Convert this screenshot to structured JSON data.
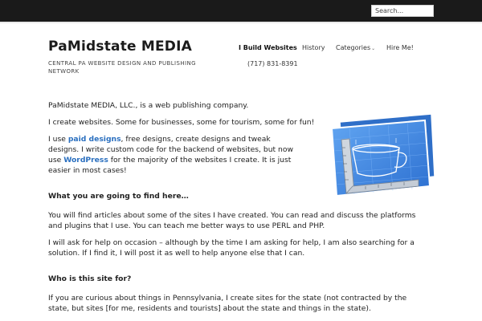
{
  "search": {
    "placeholder": "Search..."
  },
  "header": {
    "site_title": "PaMidstate MEDIA",
    "tagline": "CENTRAL PA WEBSITE DESIGN AND PUBLISHING NETWORK",
    "phone": "(717) 831-8391"
  },
  "nav": {
    "items": [
      {
        "label": "I Build Websites",
        "active": true
      },
      {
        "label": "History"
      },
      {
        "label": "Categories",
        "has_dropdown": true
      },
      {
        "label": "Hire Me!"
      }
    ]
  },
  "content": {
    "p1": "PaMidstate MEDIA, LLC., is a web publishing company.",
    "p2": "I create websites.  Some for businesses, some for tourism, some for fun!",
    "p3_a": "I use ",
    "p3_link1": "paid designs",
    "p3_b": ", free designs, create designs and tweak designs.  I  write custom code for the backend of websites, but now use ",
    "p3_link2": "WordPress",
    "p3_c": " for the majority of the websites I create.  It is just easier in most cases!",
    "h1": "What you are going to find here…",
    "p4": "You will find articles about some of the sites I have created.  You can read and  discuss the platforms and plugins that I use.  You can teach me better ways to use PERL and PHP.",
    "p5": "I will ask for help on occasion – although by the time I am asking for help, I am also searching for a solution.  If I find it, I will post it as well to help anyone else that I can.",
    "h2": "Who is this site for?",
    "p6": "If you are curious about things in Pennsylvania, I create sites for the state (not contracted by the state, but sites [for me, residents and tourists] about the state and things in the state)."
  },
  "image": {
    "icon": "blueprint-icon"
  },
  "colors": {
    "topbar": "#1a1a1a",
    "link": "#2a6fbf",
    "blueprint": "#3f86e0"
  }
}
